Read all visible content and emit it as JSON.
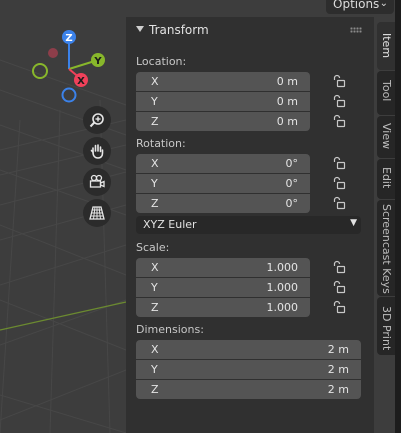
{
  "header": {
    "options_label": "Options"
  },
  "gizmo": {
    "z_label": "Z",
    "y_label": "Y",
    "x_label": "X",
    "colors": {
      "x": "#f0415a",
      "y": "#88b72b",
      "z": "#3b82ea"
    }
  },
  "nav_buttons": [
    "zoom-icon",
    "hand-pan-icon",
    "camera-icon",
    "grid-perspective-icon"
  ],
  "transform": {
    "title": "Transform",
    "location": {
      "label": "Location:",
      "x": {
        "axis": "X",
        "value": "0 m"
      },
      "y": {
        "axis": "Y",
        "value": "0 m"
      },
      "z": {
        "axis": "Z",
        "value": "0 m"
      }
    },
    "rotation": {
      "label": "Rotation:",
      "x": {
        "axis": "X",
        "value": "0°"
      },
      "y": {
        "axis": "Y",
        "value": "0°"
      },
      "z": {
        "axis": "Z",
        "value": "0°"
      },
      "mode": "XYZ Euler"
    },
    "scale": {
      "label": "Scale:",
      "x": {
        "axis": "X",
        "value": "1.000"
      },
      "y": {
        "axis": "Y",
        "value": "1.000"
      },
      "z": {
        "axis": "Z",
        "value": "1.000"
      }
    },
    "dimensions": {
      "label": "Dimensions:",
      "x": {
        "axis": "X",
        "value": "2 m"
      },
      "y": {
        "axis": "Y",
        "value": "2 m"
      },
      "z": {
        "axis": "Z",
        "value": "2 m"
      }
    }
  },
  "tabs": {
    "item": "Item",
    "tool": "Tool",
    "view": "View",
    "edit": "Edit",
    "screencast": "Screencast Keys",
    "print3d": "3D Print"
  }
}
